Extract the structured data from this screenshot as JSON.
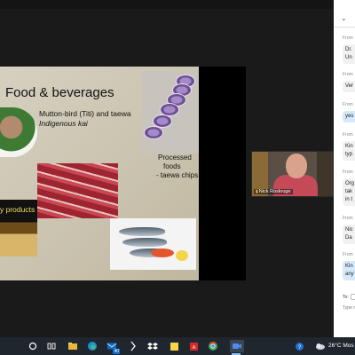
{
  "slide": {
    "title": "Food & beverages",
    "bird_caption_line1": "Mutton-bird (Titi) and taewa",
    "bird_caption_line2": "Indigenous kai",
    "chips_caption_line1": "Processed",
    "chips_caption_line2": "foods",
    "chips_caption_line3": "- taewa chips",
    "dairy_caption": "y products"
  },
  "video": {
    "participant_name": "Nick Roskruge"
  },
  "chat": {
    "messages": [
      {
        "from": "From",
        "text": "Dr.",
        "text2": "Un",
        "style": "grey"
      },
      {
        "from": "From",
        "text": "Ver",
        "style": "grey"
      },
      {
        "from": "From",
        "text": "yes",
        "style": "blue"
      },
      {
        "from": "From",
        "text": "Kin",
        "text2": "typ",
        "style": "grey"
      },
      {
        "from": "From",
        "text": "Org",
        "text2": "tak",
        "text3": "in t",
        "style": "grey"
      },
      {
        "from": "From",
        "text": "Nic",
        "text2": "Da",
        "style": "grey"
      },
      {
        "from": "From",
        "text": "Kin",
        "text2": "any",
        "style": "blue"
      }
    ],
    "to_label": "To:",
    "input_placeholder": "Type m"
  },
  "taskbar": {
    "temperature": "26°C",
    "tray_text": "Mos",
    "badge_count": "40",
    "icons": [
      "start-icon",
      "search-icon",
      "task-view-icon",
      "file-explorer-icon",
      "edge-icon",
      "mail-icon",
      "arrow-icon",
      "dropbox-icon",
      "sticky-notes-icon",
      "pdf-icon",
      "chrome-icon",
      "zoom-icon"
    ]
  },
  "colors": {
    "slide_bg": "#cfc8b5",
    "taskbar": "#20262d",
    "chat_blue": "#d6e8fb"
  }
}
